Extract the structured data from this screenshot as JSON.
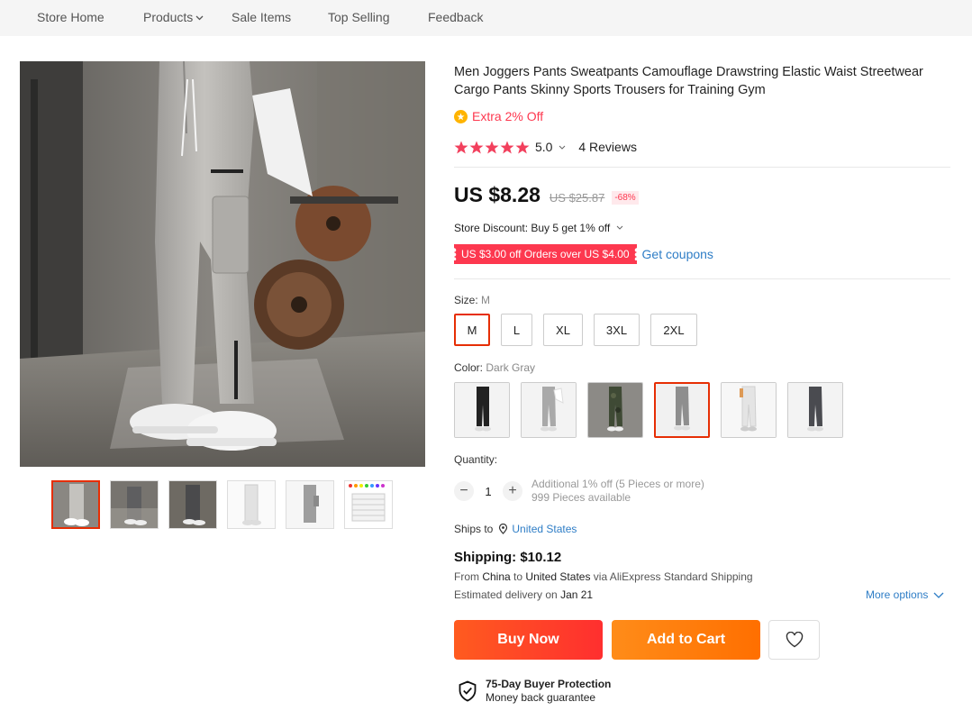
{
  "nav": {
    "items": [
      "Store Home",
      "Products",
      "Sale Items",
      "Top Selling",
      "Feedback"
    ]
  },
  "product": {
    "title": "Men Joggers Pants Sweatpants Camouflage Drawstring Elastic Waist Streetwear Cargo Pants Skinny Sports Trousers for Training Gym",
    "extra_off": "Extra 2% Off",
    "rating": "5.0",
    "rating_stars": 5,
    "reviews": "4 Reviews",
    "price": "US $8.28",
    "old_price": "US $25.87",
    "discount": "-68%",
    "store_discount": "Store Discount: Buy 5 get 1% off",
    "coupon": "US $3.00 off Orders over US $4.00",
    "get_coupons": "Get coupons"
  },
  "size": {
    "label": "Size:",
    "selected": "M",
    "options": [
      "M",
      "L",
      "XL",
      "3XL",
      "2XL"
    ]
  },
  "color": {
    "label": "Color:",
    "selected": "Dark Gray",
    "option_count": 6
  },
  "quantity": {
    "label": "Quantity:",
    "value": "1",
    "minus": "−",
    "plus": "+",
    "additional": "Additional 1% off (5 Pieces or more)",
    "available": "999 Pieces available"
  },
  "shipping": {
    "ships_to_label": "Ships to",
    "country": "United States",
    "title": "Shipping: $10.12",
    "from_prefix": "From",
    "from_country": "China",
    "to_word": "to",
    "to_country": "United States",
    "via": "via AliExpress Standard Shipping",
    "delivery_prefix": "Estimated delivery on",
    "delivery_date": "Jan 21",
    "more_options": "More options"
  },
  "actions": {
    "buy_now": "Buy Now",
    "add_to_cart": "Add to Cart"
  },
  "protection": {
    "title": "75-Day Buyer Protection",
    "subtitle": "Money back guarantee"
  },
  "colors": {
    "accent": "#e62e04",
    "price_red": "#fd384f",
    "link_blue": "#2e7dc6",
    "buy_now": "#ff4a22",
    "add_to_cart": "#ff8000"
  }
}
